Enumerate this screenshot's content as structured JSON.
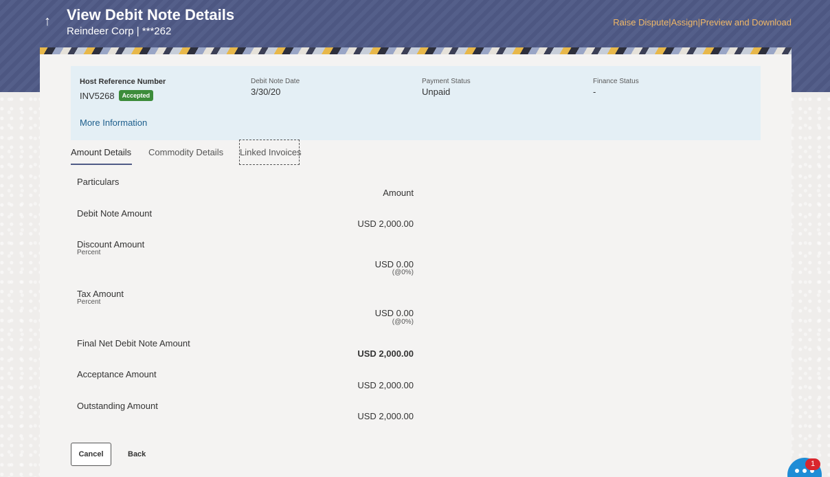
{
  "header": {
    "title": "View Debit Note Details",
    "subtitle": "Reindeer Corp | ***262",
    "actions": {
      "raise_dispute": "Raise Dispute",
      "sep1": "|",
      "assign": "Assign",
      "sep2": "|",
      "preview_download": "Preview and Download"
    }
  },
  "summary": {
    "host_ref_label": "Host Reference Number",
    "host_ref_value": "INV5268",
    "status_badge": "Accepted",
    "date_label": "Debit Note Date",
    "date_value": "3/30/20",
    "payment_label": "Payment Status",
    "payment_value": "Unpaid",
    "finance_label": "Finance Status",
    "finance_value": "-",
    "more_info": "More Information"
  },
  "tabs": {
    "amount": "Amount Details",
    "commodity": "Commodity Details",
    "linked": "Linked Invoices"
  },
  "details": {
    "particulars_label": "Particulars",
    "amount_header": "Amount",
    "debit_note_amount_label": "Debit Note Amount",
    "debit_note_amount_value": "USD 2,000.00",
    "discount_label": "Discount Amount",
    "discount_sub": "Percent",
    "discount_value": "USD 0.00",
    "discount_pct": "(@0%)",
    "tax_label": "Tax Amount",
    "tax_sub": "Percent",
    "tax_value": "USD 0.00",
    "tax_pct": "(@0%)",
    "final_label": "Final Net Debit Note Amount",
    "final_value": "USD 2,000.00",
    "acceptance_label": "Acceptance Amount",
    "acceptance_value": "USD 2,000.00",
    "outstanding_label": "Outstanding Amount",
    "outstanding_value": "USD 2,000.00"
  },
  "buttons": {
    "cancel": "Cancel",
    "back": "Back"
  },
  "chat": {
    "badge_count": "1"
  },
  "colors": {
    "header_bg": "#4f5a86",
    "accent_orange": "#f1b867",
    "badge_green": "#3c8c3a",
    "link_blue": "#1d5e8c",
    "chat_blue": "#1f8dd6"
  }
}
